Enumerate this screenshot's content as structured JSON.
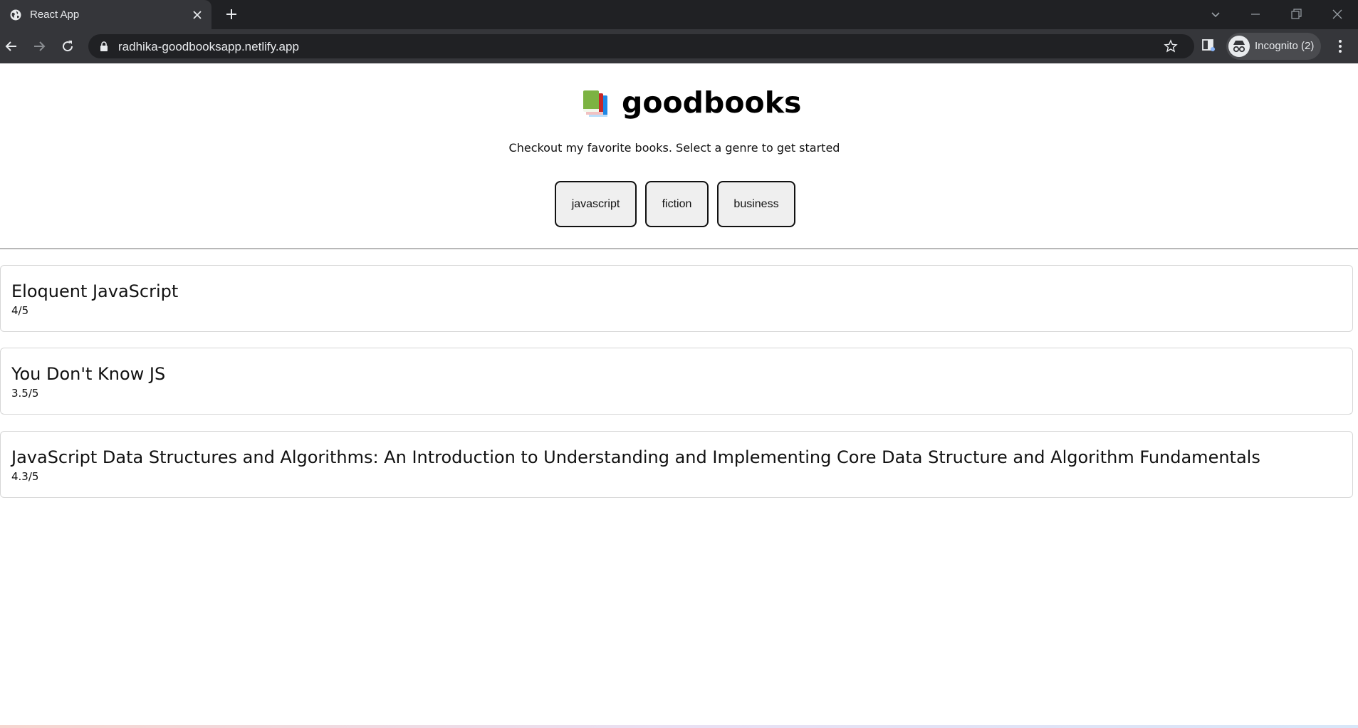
{
  "browser": {
    "tab": {
      "title": "React App",
      "favicon": "globe-icon"
    },
    "address": {
      "url": "radhika-goodbooksapp.netlify.app"
    },
    "profile": {
      "label": "Incognito (2)"
    }
  },
  "app": {
    "title": "goodbooks",
    "logo_icon": "books-icon",
    "subtitle": "Checkout my favorite books. Select a genre to get started"
  },
  "genres": [
    {
      "label": "javascript"
    },
    {
      "label": "fiction"
    },
    {
      "label": "business"
    }
  ],
  "books": [
    {
      "name": "Eloquent JavaScript",
      "rating": "4/5"
    },
    {
      "name": "You Don't Know JS",
      "rating": "3.5/5"
    },
    {
      "name": "JavaScript Data Structures and Algorithms: An Introduction to Understanding and Implementing Core Data Structure and Algorithm Fundamentals",
      "rating": "4.3/5"
    }
  ],
  "colors": {
    "chrome_dark": "#202124",
    "chrome_tab": "#35363a",
    "button_bg": "#efefef",
    "card_border": "#d6d6d6"
  }
}
